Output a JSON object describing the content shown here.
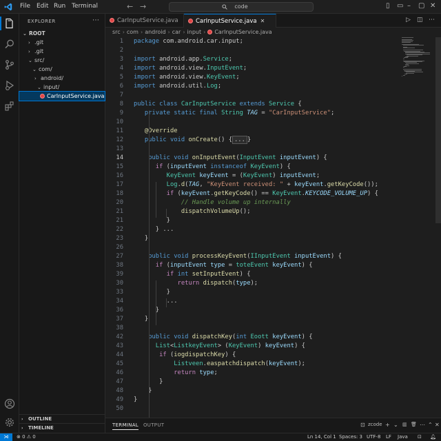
{
  "titlebar": {
    "menu": [
      "File",
      "Edit",
      "Run",
      "Terminal"
    ],
    "command_center": "code"
  },
  "sidebar": {
    "title": "EXPLORER",
    "more": "⋯",
    "tree": [
      {
        "label": "ROOT",
        "chev": "⌄",
        "bold": true
      },
      {
        "label": ".git",
        "chev": "›"
      },
      {
        "label": ".git",
        "chev": "›"
      },
      {
        "label": "src/",
        "chev": "⌄"
      },
      {
        "label": "com/",
        "chev": "⌄"
      },
      {
        "label": "android/",
        "chev": "›"
      },
      {
        "label": "input/",
        "chev": "⌄"
      },
      {
        "label": "CarInputService.java",
        "file": true,
        "selected": true
      }
    ],
    "outline": "OUTLINE",
    "timeline": "TIMELINE"
  },
  "tabs": [
    {
      "label": "CarInputService.java",
      "active": false
    },
    {
      "label": "CarInputService.java",
      "active": true
    }
  ],
  "breadcrumb": [
    "src",
    "com",
    "android",
    "car",
    "input",
    "CarInputService.java"
  ],
  "code": {
    "current_line": 14,
    "lines": [
      {
        "n": 1,
        "html": "<span class='kw'>package</span> com.android.car.input;"
      },
      {
        "n": 2,
        "html": ""
      },
      {
        "n": 3,
        "html": "<span class='kw'>import</span> android.app.<span class='ty'>Service</span>;"
      },
      {
        "n": 4,
        "html": "<span class='kw'>import</span> android.view.<span class='ty'>InputEvent</span>;"
      },
      {
        "n": 5,
        "html": "<span class='kw'>import</span> android.view.<span class='ty'>KeyEvent</span>;"
      },
      {
        "n": 6,
        "html": "<span class='kw'>import</span> android.util.<span class='ty'>Log</span>;"
      },
      {
        "n": 7,
        "html": ""
      },
      {
        "n": 8,
        "html": "<span class='kw'>public class</span> <span class='ty'>CarInputService</span> <span class='kw'>extends</span> <span class='ty'>Service</span> {"
      },
      {
        "n": 9,
        "html": "   <span class='kw'>private static final</span> <span class='ty'>String</span> <span class='it'>TAG</span> = <span class='str'>\"CarInputService\"</span>;"
      },
      {
        "n": 10,
        "html": ""
      },
      {
        "n": 11,
        "html": "   <span class='an'>@Override</span>"
      },
      {
        "n": 12,
        "html": "   <span class='kw'>public void</span> <span class='fn'>onCreate</span>() {<span class='fold'>...</span>}"
      },
      {
        "n": 13,
        "html": ""
      },
      {
        "n": 14,
        "html": "    <span class='kw'>public void</span> <span class='fn'>onInputEvent</span>(<span class='ty'>InputEvent</span> <span class='var'>inputEvent</span>) {"
      },
      {
        "n": 15,
        "html": "      <span class='kw2'>if</span> (<span class='var'>inputEvent</span> <span class='kw'>instanceof</span> <span class='ty'>KeyEvent</span>) {"
      },
      {
        "n": 16,
        "html": "         <span class='ty'>KeyEvent</span> <span class='var'>keyEvent</span> = (<span class='ty'>KeyEvent</span>) <span class='var'>inputEvent</span>;"
      },
      {
        "n": 17,
        "html": "         <span class='ty'>Log</span>.<span class='fn'>d</span>(<span class='it'>TAG</span>, <span class='str'>\"KeyEvent received: \"</span> + <span class='var'>keyEvent</span>.<span class='fn'>getKeyCode</span>());"
      },
      {
        "n": 18,
        "html": "         <span class='kw2'>if</span> (<span class='var'>keyEvent</span>.<span class='fn'>getKeyCode</span>() == <span class='ty'>KeyEvent</span>.<span class='it'>KEYCODE_VOLUME_UP</span>) {"
      },
      {
        "n": 20,
        "html": "             <span class='cm'>// Handle volume up internally</span>"
      },
      {
        "n": 21,
        "html": "             <span class='fn'>dispatchVolumeUp</span>();"
      },
      {
        "n": 21,
        "html": "         }"
      },
      {
        "n": 22,
        "html": "      } ..."
      },
      {
        "n": 23,
        "html": "   }"
      },
      {
        "n": 26,
        "html": ""
      },
      {
        "n": 27,
        "html": "    <span class='kw'>public void</span> <span class='fn'>processKeyEvent</span>(<span class='ty'>IInputEvent</span> <span class='var'>inputEvent</span>) {"
      },
      {
        "n": 38,
        "html": "      <span class='kw2'>if</span> (<span class='var'>inputEvent</span> <span class='var'>type</span> = <span class='ty'>toteEvent</span> <span class='var'>keyEvent</span>) {"
      },
      {
        "n": 39,
        "html": "         <span class='kw2'>if</span> <span class='kw'>int</span> <span class='fn'>setInputEvent</span>) {"
      },
      {
        "n": 30,
        "html": "            <span class='kw2'>return</span> <span class='fn'>dispatch</span>(<span class='var'>type</span>);"
      },
      {
        "n": 33,
        "html": "         }"
      },
      {
        "n": 34,
        "html": "         ..."
      },
      {
        "n": 36,
        "html": "      }"
      },
      {
        "n": 37,
        "html": "   }"
      },
      {
        "n": 38,
        "html": ""
      },
      {
        "n": 42,
        "html": "    <span class='kw'>public void</span> <span class='fn'>dispatchKey</span>(<span class='kw'>int</span> <span class='ty'>Eoott</span> <span class='var'>keyEvent</span>) {"
      },
      {
        "n": 43,
        "html": "      <span class='ty'>List</span>&lt;<span class='ty'>ListkeyEvent</span>&gt; (<span class='ty'>KeyEvent</span>) <span class='var'>keyEvent</span>) {"
      },
      {
        "n": 44,
        "html": "       <span class='kw2'>if</span> (<span class='fn'>iogdispatchKey</span>) {"
      },
      {
        "n": 45,
        "html": "           <span class='ty'>Listveen</span>.<span class='fn'>easpatchdispatch</span>(<span class='var'>keyEvent</span>);"
      },
      {
        "n": 46,
        "html": "           <span class='kw2'>return</span> <span class='var'>type</span>;"
      },
      {
        "n": 47,
        "html": "       }"
      },
      {
        "n": 48,
        "html": "    }"
      },
      {
        "n": 49,
        "html": "}"
      },
      {
        "n": 50,
        "html": ""
      }
    ]
  },
  "panel": {
    "tabs": [
      "TERMINAL",
      "OUTPUT"
    ],
    "shell": "zcode",
    "tools": [
      "+",
      "⌄",
      "🗑",
      "⋯",
      "⌃",
      "✕"
    ]
  },
  "statusbar": {
    "remote": "⋊",
    "problems": "⊗ 0 ⚠ 0",
    "position": "Ln 14, Col 1",
    "spaces": "Spaces: 3",
    "encoding": "UTF-8",
    "eol": "LF",
    "language": "Java"
  },
  "colors": {
    "accent": "#0078d4",
    "editor_bg": "#1e1e1e",
    "sidebar_bg": "#181818"
  }
}
